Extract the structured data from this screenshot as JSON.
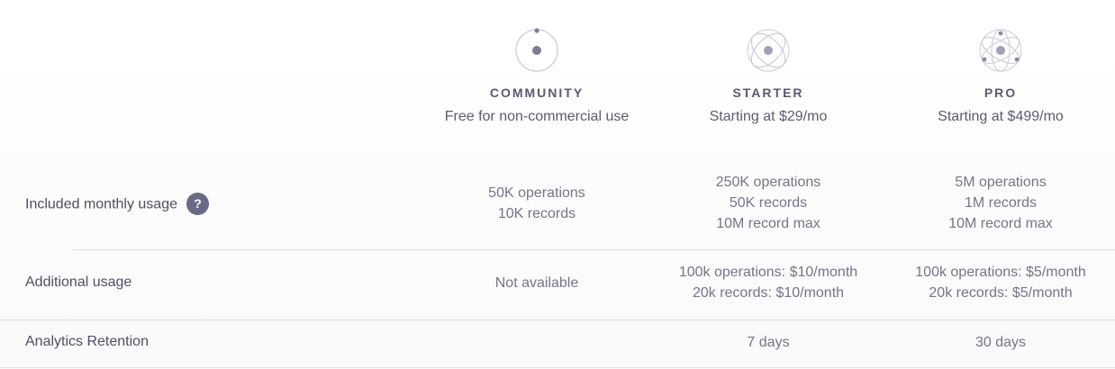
{
  "plans": [
    {
      "name": "COMMUNITY",
      "price": "Free for non-commercial use",
      "icon": "orbit-single-icon"
    },
    {
      "name": "STARTER",
      "price": "Starting at $29/mo",
      "icon": "orbit-double-icon"
    },
    {
      "name": "PRO",
      "price": "Starting at $499/mo",
      "icon": "orbit-triple-icon"
    }
  ],
  "rows": [
    {
      "label": "Included monthly usage",
      "help": "?",
      "cells": [
        [
          "50K operations",
          "10K records"
        ],
        [
          "250K operations",
          "50K records",
          "10M record max"
        ],
        [
          "5M operations",
          "1M records",
          "10M record max"
        ]
      ]
    },
    {
      "label": "Additional usage",
      "cells": [
        [
          "Not available"
        ],
        [
          "100k operations: $10/month",
          "20k records: $10/month"
        ],
        [
          "100k operations: $5/month",
          "20k records: $5/month"
        ]
      ]
    },
    {
      "label": "Analytics Retention",
      "cells": [
        [],
        [
          "7 days"
        ],
        [
          "30 days"
        ]
      ]
    }
  ],
  "colors": {
    "accent": "#6b6a86",
    "icon_stroke": "#cfcbd9",
    "icon_dot": "#8e8aa3"
  }
}
